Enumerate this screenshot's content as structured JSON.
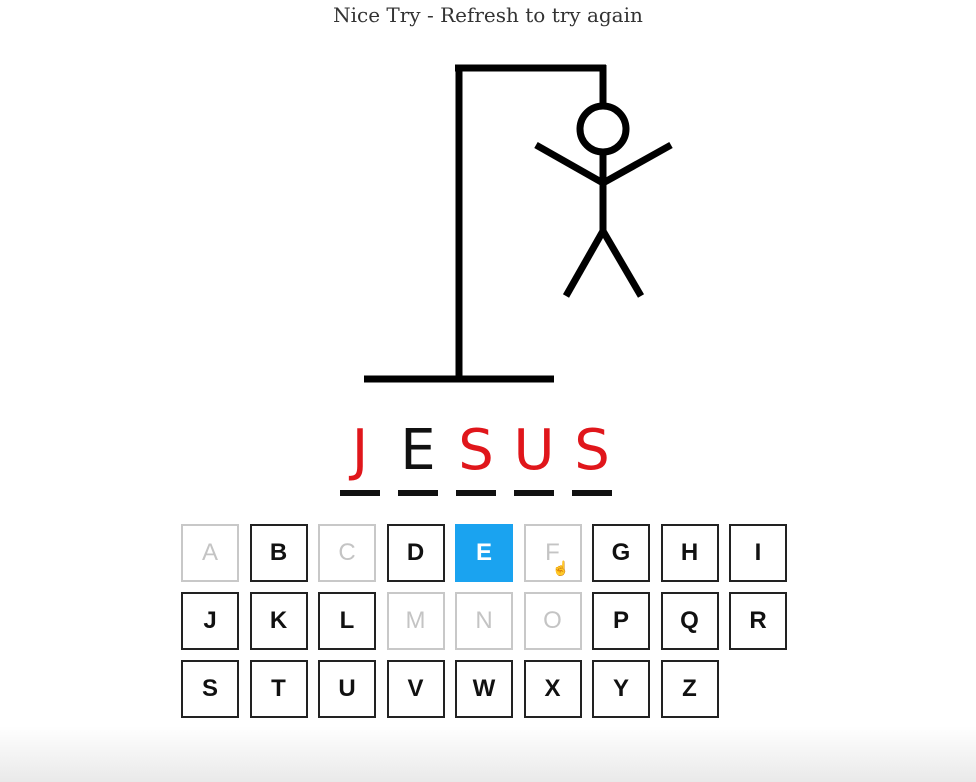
{
  "status_message": "Nice Try - Refresh to try again",
  "drawing": {
    "parts": [
      "base",
      "pole",
      "beam",
      "rope",
      "head",
      "body",
      "left-arm",
      "right-arm",
      "left-leg",
      "right-leg"
    ],
    "color": "#000000"
  },
  "word": [
    {
      "char": "J",
      "revealed_by_player": false
    },
    {
      "char": "E",
      "revealed_by_player": true
    },
    {
      "char": "S",
      "revealed_by_player": false
    },
    {
      "char": "U",
      "revealed_by_player": false
    },
    {
      "char": "S",
      "revealed_by_player": false
    }
  ],
  "colors": {
    "missed_letter": "#e0161b",
    "guessed_letter": "#111111",
    "key_active_bg": "#1aa3f0",
    "key_used_text": "#c4c4c4"
  },
  "keyboard": {
    "keys": [
      {
        "letter": "A",
        "state": "used"
      },
      {
        "letter": "B",
        "state": "available"
      },
      {
        "letter": "C",
        "state": "used"
      },
      {
        "letter": "D",
        "state": "available"
      },
      {
        "letter": "E",
        "state": "active"
      },
      {
        "letter": "F",
        "state": "used"
      },
      {
        "letter": "G",
        "state": "available"
      },
      {
        "letter": "H",
        "state": "available"
      },
      {
        "letter": "I",
        "state": "available"
      },
      {
        "letter": "J",
        "state": "available"
      },
      {
        "letter": "K",
        "state": "available"
      },
      {
        "letter": "L",
        "state": "available"
      },
      {
        "letter": "M",
        "state": "used"
      },
      {
        "letter": "N",
        "state": "used"
      },
      {
        "letter": "O",
        "state": "used"
      },
      {
        "letter": "P",
        "state": "available"
      },
      {
        "letter": "Q",
        "state": "available"
      },
      {
        "letter": "R",
        "state": "available"
      },
      {
        "letter": "S",
        "state": "available"
      },
      {
        "letter": "T",
        "state": "available"
      },
      {
        "letter": "U",
        "state": "available"
      },
      {
        "letter": "V",
        "state": "available"
      },
      {
        "letter": "W",
        "state": "available"
      },
      {
        "letter": "X",
        "state": "available"
      },
      {
        "letter": "Y",
        "state": "available"
      },
      {
        "letter": "Z",
        "state": "available"
      }
    ]
  },
  "cursor": {
    "icon": "hand-pointer-icon"
  }
}
